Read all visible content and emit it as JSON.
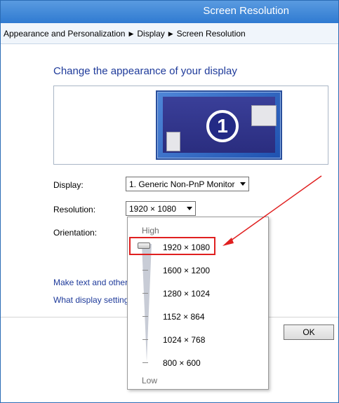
{
  "window": {
    "title": "Screen Resolution"
  },
  "breadcrumb": [
    "Appearance and Personalization",
    "Display",
    "Screen Resolution"
  ],
  "main": {
    "heading": "Change the appearance of your display",
    "monitor_number": "1",
    "display": {
      "label": "Display:",
      "value": "1. Generic Non-PnP Monitor"
    },
    "resolution": {
      "label": "Resolution:",
      "value": "1920 × 1080"
    },
    "orientation": {
      "label": "Orientation:"
    },
    "links": [
      "Make text and other",
      "What display setting"
    ],
    "ok_label": "OK"
  },
  "dropdown": {
    "high_label": "High",
    "low_label": "Low",
    "options": [
      "1920 × 1080",
      "1600 × 1200",
      "1280 × 1024",
      "1152 × 864",
      "1024 × 768",
      "800 × 600"
    ],
    "selected": "1920 × 1080"
  },
  "annotation": {
    "color": "#e02020"
  }
}
